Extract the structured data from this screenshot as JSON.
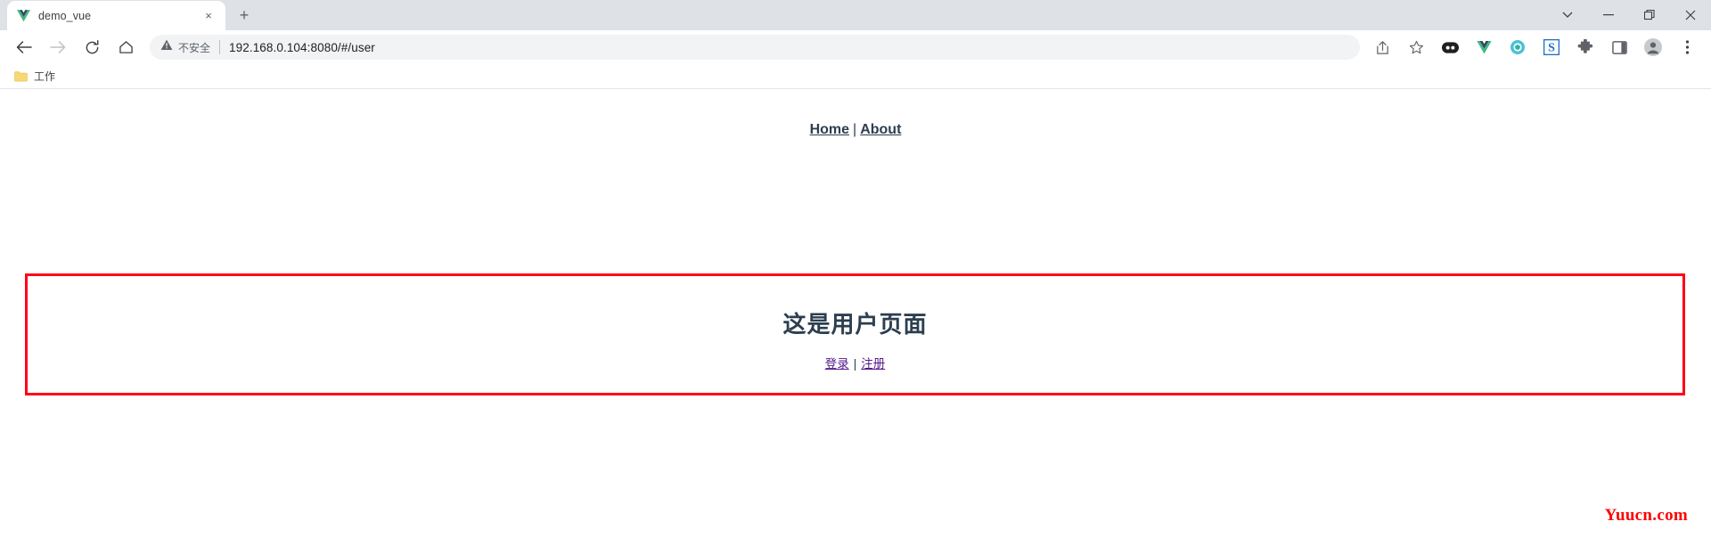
{
  "browser": {
    "tab": {
      "title": "demo_vue",
      "favicon": "vue-logo-icon",
      "close_label": "×"
    },
    "new_tab_label": "+",
    "window_controls": [
      {
        "name": "tab-search-button",
        "glyph": "⌄"
      },
      {
        "name": "minimize-button",
        "glyph": "—"
      },
      {
        "name": "maximize-button",
        "glyph": "❐"
      },
      {
        "name": "close-window-button",
        "glyph": "✕"
      }
    ],
    "nav_buttons": [
      {
        "name": "back-button",
        "glyph": "←",
        "enabled": "true"
      },
      {
        "name": "forward-button",
        "glyph": "→",
        "enabled": "false"
      },
      {
        "name": "reload-button",
        "glyph": "↻",
        "enabled": "true"
      },
      {
        "name": "home-button",
        "glyph": "⌂",
        "enabled": "true"
      }
    ],
    "omnibox": {
      "security_label": "不安全",
      "security_icon": "warning-triangle-icon",
      "url": "192.168.0.104:8080/#/user",
      "url_host": "192.168.0.104",
      "url_rest": ":8080/#/user"
    },
    "toolbar_right": [
      {
        "name": "share-icon",
        "title": "share"
      },
      {
        "name": "bookmark-star-icon",
        "title": "bookmark"
      },
      {
        "name": "extension-dark-eyes-icon",
        "title": "extension"
      },
      {
        "name": "vue-devtools-icon",
        "title": "Vue devtools"
      },
      {
        "name": "teal-circle-extension-icon",
        "title": "extension"
      },
      {
        "name": "blue-s-extension-icon",
        "title": "extension"
      },
      {
        "name": "extensions-puzzle-icon",
        "title": "extensions"
      },
      {
        "name": "side-panel-icon",
        "title": "side panel"
      },
      {
        "name": "profile-avatar-icon",
        "title": "profile"
      },
      {
        "name": "chrome-menu-icon",
        "title": "menu"
      }
    ],
    "bookmarks": [
      {
        "label": "工作",
        "icon": "folder-icon"
      }
    ]
  },
  "page": {
    "nav": {
      "home_label": "Home",
      "separator": "|",
      "about_label": "About"
    },
    "user_box": {
      "heading": "这是用户页面",
      "login_label": "登录",
      "separator": "|",
      "register_label": "注册"
    },
    "watermark": "Yuucn.com"
  },
  "colors": {
    "box_border": "#ff0019",
    "heading": "#2c3e50",
    "visited_link": "#551a8b",
    "watermark": "#ff0000",
    "tabstrip_bg": "#dee1e6",
    "omnibox_bg": "#f1f3f4"
  }
}
